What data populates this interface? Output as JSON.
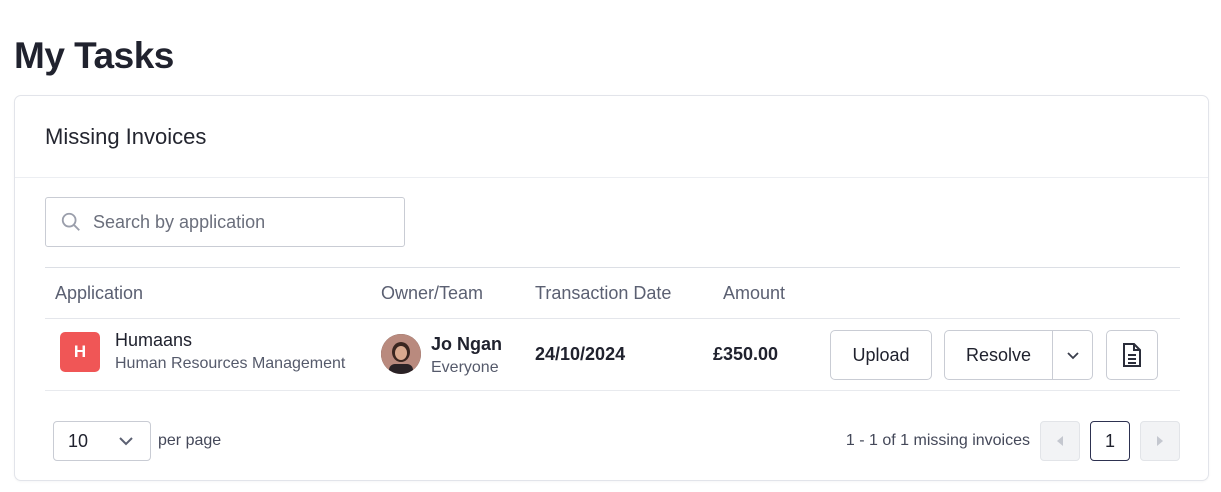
{
  "page": {
    "title": "My Tasks"
  },
  "card": {
    "title": "Missing Invoices"
  },
  "search": {
    "placeholder": "Search by application",
    "value": ""
  },
  "table": {
    "columns": [
      "Application",
      "Owner/Team",
      "Transaction Date",
      "Amount"
    ],
    "rows": [
      {
        "app_initial": "H",
        "app_name": "Humaans",
        "app_category": "Human Resources Management",
        "app_color": "#f05656",
        "owner_name": "Jo Ngan",
        "owner_team": "Everyone",
        "date": "24/10/2024",
        "amount": "£350.00",
        "actions": {
          "upload": "Upload",
          "resolve": "Resolve"
        }
      }
    ]
  },
  "footer": {
    "per_page_value": "10",
    "per_page_label": "per page",
    "range_text": "1 - 1 of 1 missing invoices",
    "current_page": "1"
  },
  "icons": {
    "search": "search-icon",
    "resolve_menu": "chevron-down-icon",
    "document": "document-icon",
    "per_page": "chevron-down-icon",
    "prev": "caret-left-icon",
    "next": "caret-right-icon"
  }
}
